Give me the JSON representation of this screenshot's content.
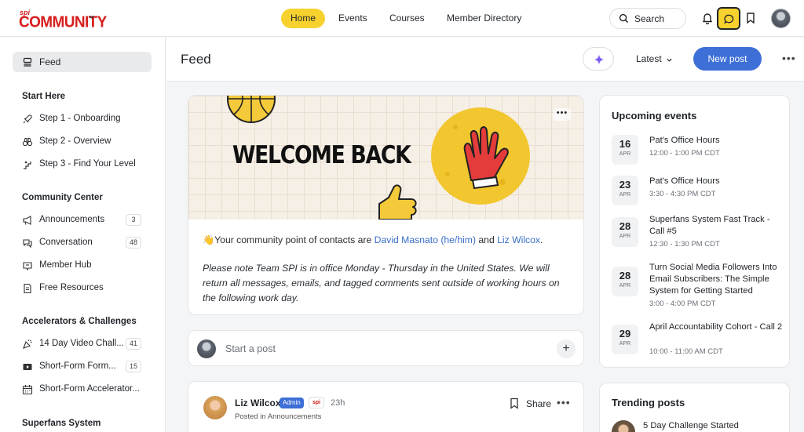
{
  "brand": {
    "small": "spi",
    "name": "COMMUNITY"
  },
  "topnav": {
    "items": [
      {
        "label": "Home",
        "active": true
      },
      {
        "label": "Events"
      },
      {
        "label": "Courses"
      },
      {
        "label": "Member Directory"
      }
    ],
    "search_label": "Search"
  },
  "sidebar": {
    "feed_label": "Feed",
    "sections": [
      {
        "title": "Start Here",
        "items": [
          {
            "label": "Step 1 - Onboarding",
            "icon": "rocket-icon"
          },
          {
            "label": "Step 2 - Overview",
            "icon": "binoculars-icon"
          },
          {
            "label": "Step 3 - Find Your Level",
            "icon": "stairs-icon"
          }
        ]
      },
      {
        "title": "Community Center",
        "items": [
          {
            "label": "Announcements",
            "icon": "megaphone-icon",
            "count": "3"
          },
          {
            "label": "Conversation",
            "icon": "chat-bubbles-icon",
            "count": "48"
          },
          {
            "label": "Member Hub",
            "icon": "hub-icon"
          },
          {
            "label": "Free Resources",
            "icon": "document-icon"
          }
        ]
      },
      {
        "title": "Accelerators & Challenges",
        "items": [
          {
            "label": "14 Day Video Chall...",
            "icon": "party-popper-icon",
            "count": "41"
          },
          {
            "label": "Short-Form Form...",
            "icon": "video-icon",
            "count": "15"
          },
          {
            "label": "Short-Form Accelerator...",
            "icon": "calendar-icon"
          }
        ]
      },
      {
        "title": "Superfans System",
        "items": []
      }
    ]
  },
  "feed_header": {
    "title": "Feed",
    "sort_label": "Latest",
    "new_post_label": "New post"
  },
  "welcome_post": {
    "banner_title": "WELCOME BACK",
    "intro_prefix": "👋Your community point of contacts are ",
    "contact1": "David Masnato (he/him)",
    "intro_and": " and ",
    "contact2": "Liz Wilcox",
    "intro_suffix": ".",
    "note": "Please note Team SPI is in office Monday - Thursday in the United States. We will return all messages, emails, and tagged comments sent outside of working hours on the following work day."
  },
  "composer": {
    "placeholder": "Start a post"
  },
  "post": {
    "author": "Liz Wilcox",
    "admin_badge": "Admin",
    "brand_badge": "spi",
    "time": "23h",
    "posted_prefix": "Posted in ",
    "posted_space": "Announcements",
    "share_label": "Share"
  },
  "events": {
    "title": "Upcoming events",
    "items": [
      {
        "day": "16",
        "month": "APR",
        "title": "Pat's Office Hours",
        "time": "12:00 - 1:00 PM CDT"
      },
      {
        "day": "23",
        "month": "APR",
        "title": "Pat's Office Hours",
        "time": "3:30 - 4:30 PM CDT"
      },
      {
        "day": "28",
        "month": "APR",
        "title": "Superfans System Fast Track - Call #5",
        "time": "12:30 - 1:30 PM CDT"
      },
      {
        "day": "28",
        "month": "APR",
        "title": "Turn Social Media Followers Into Email Subscribers: The Simple System for Getting Started",
        "time": "3:00 - 4:00 PM CDT"
      },
      {
        "day": "29",
        "month": "APR",
        "title": "April Accountability Cohort - Call 2",
        "time": "10:00 - 11:00 AM CDT"
      }
    ]
  },
  "trending": {
    "title": "Trending posts",
    "first_post": "5 Day Challenge Started"
  },
  "colors": {
    "accent_yellow": "#f7d22f",
    "primary_blue": "#3d6fd6",
    "brand_red": "#d81e1e"
  }
}
